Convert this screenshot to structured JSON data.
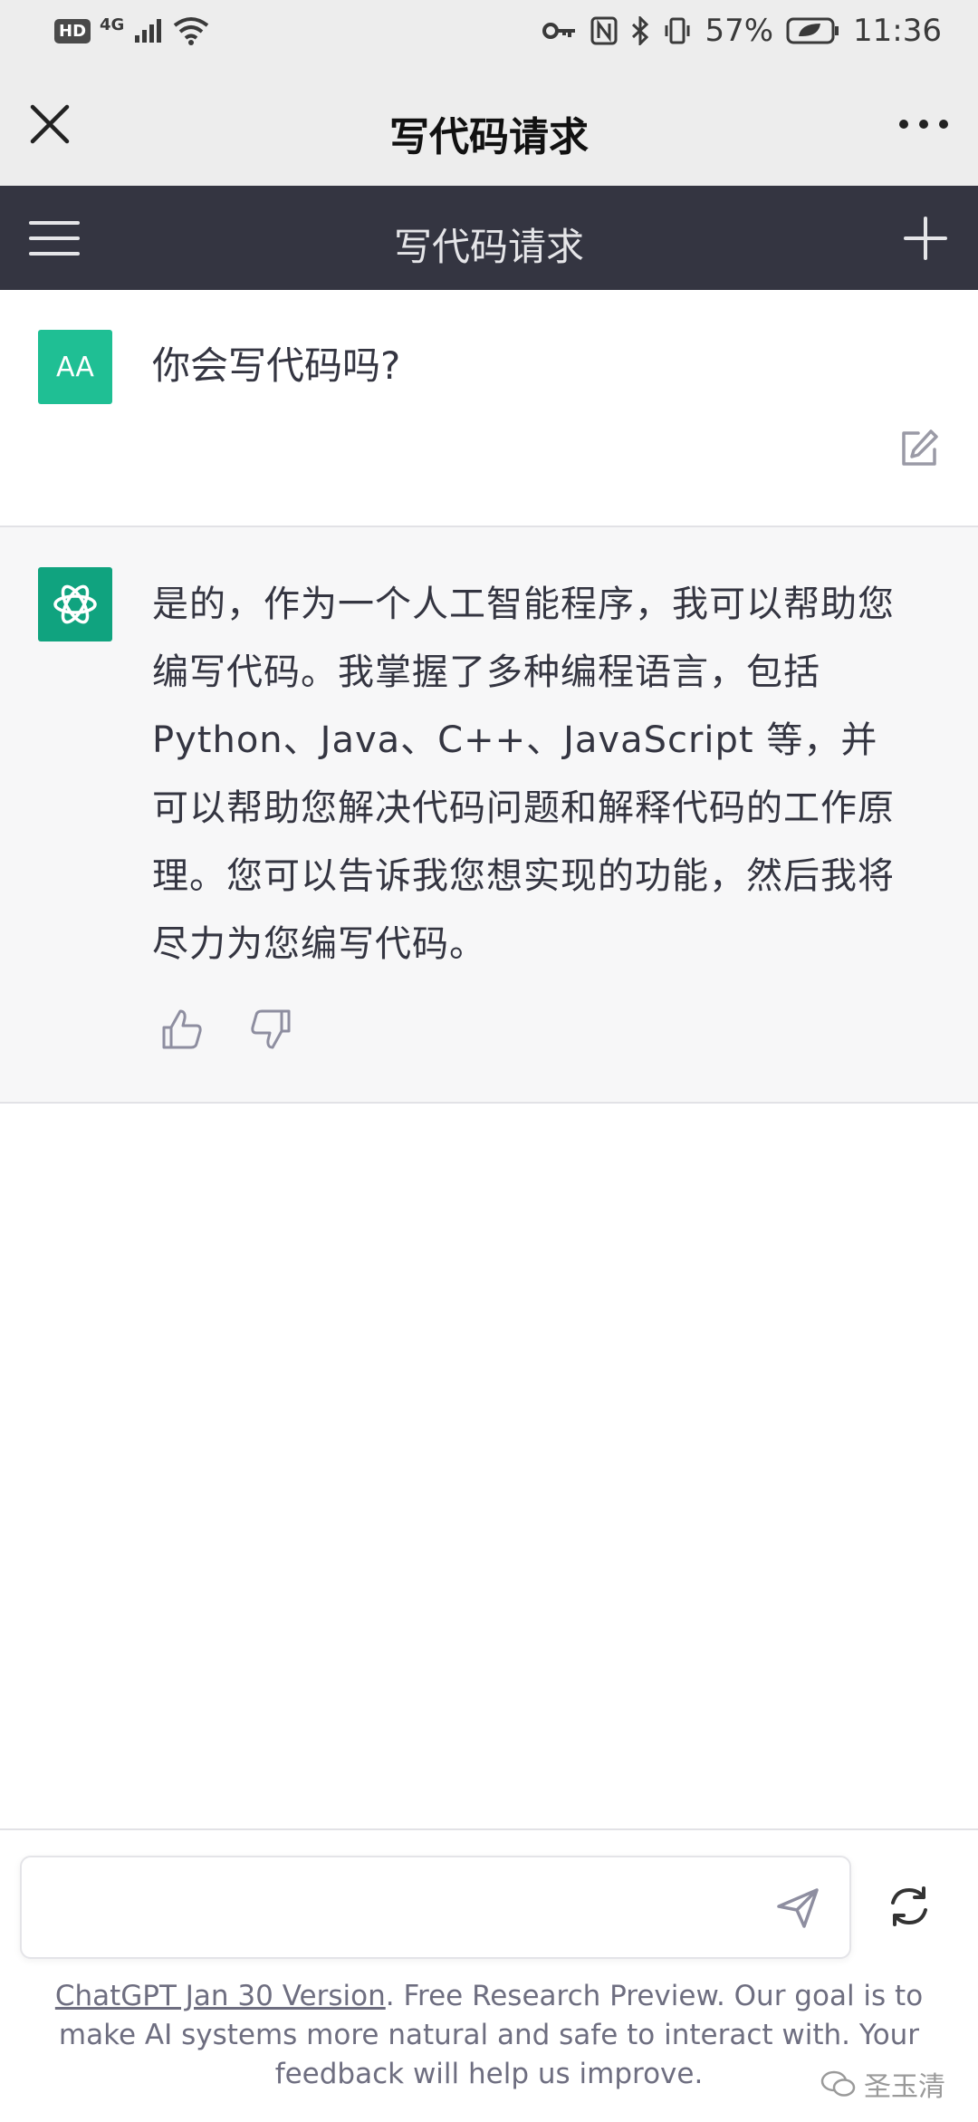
{
  "status_bar": {
    "hd": "HD",
    "network": "4G",
    "battery_pct": "57%",
    "time": "11:36"
  },
  "top_bar": {
    "title": "写代码请求"
  },
  "nav_bar": {
    "title": "写代码请求"
  },
  "user_message": {
    "avatar_initials": "AA",
    "text": "你会写代码吗?"
  },
  "assistant_message": {
    "text": "是的，作为一个人工智能程序，我可以帮助您编写代码。我掌握了多种编程语言，包括 Python、Java、C++、JavaScript 等，并可以帮助您解决代码问题和解释代码的工作原理。您可以告诉我您想实现的功能，然后我将尽力为您编写代码。"
  },
  "composer": {
    "placeholder": ""
  },
  "footer": {
    "link_text": "ChatGPT Jan 30 Version",
    "text": ". Free Research Preview. Our goal is to make AI systems more natural and safe to interact with. Your feedback will help us improve."
  },
  "watermark": {
    "text": "圣玉清"
  },
  "colors": {
    "nav_bg": "#343541",
    "user_avatar": "#1fbf94",
    "bot_avatar": "#10a37f",
    "assistant_bg": "#f7f7f8"
  }
}
